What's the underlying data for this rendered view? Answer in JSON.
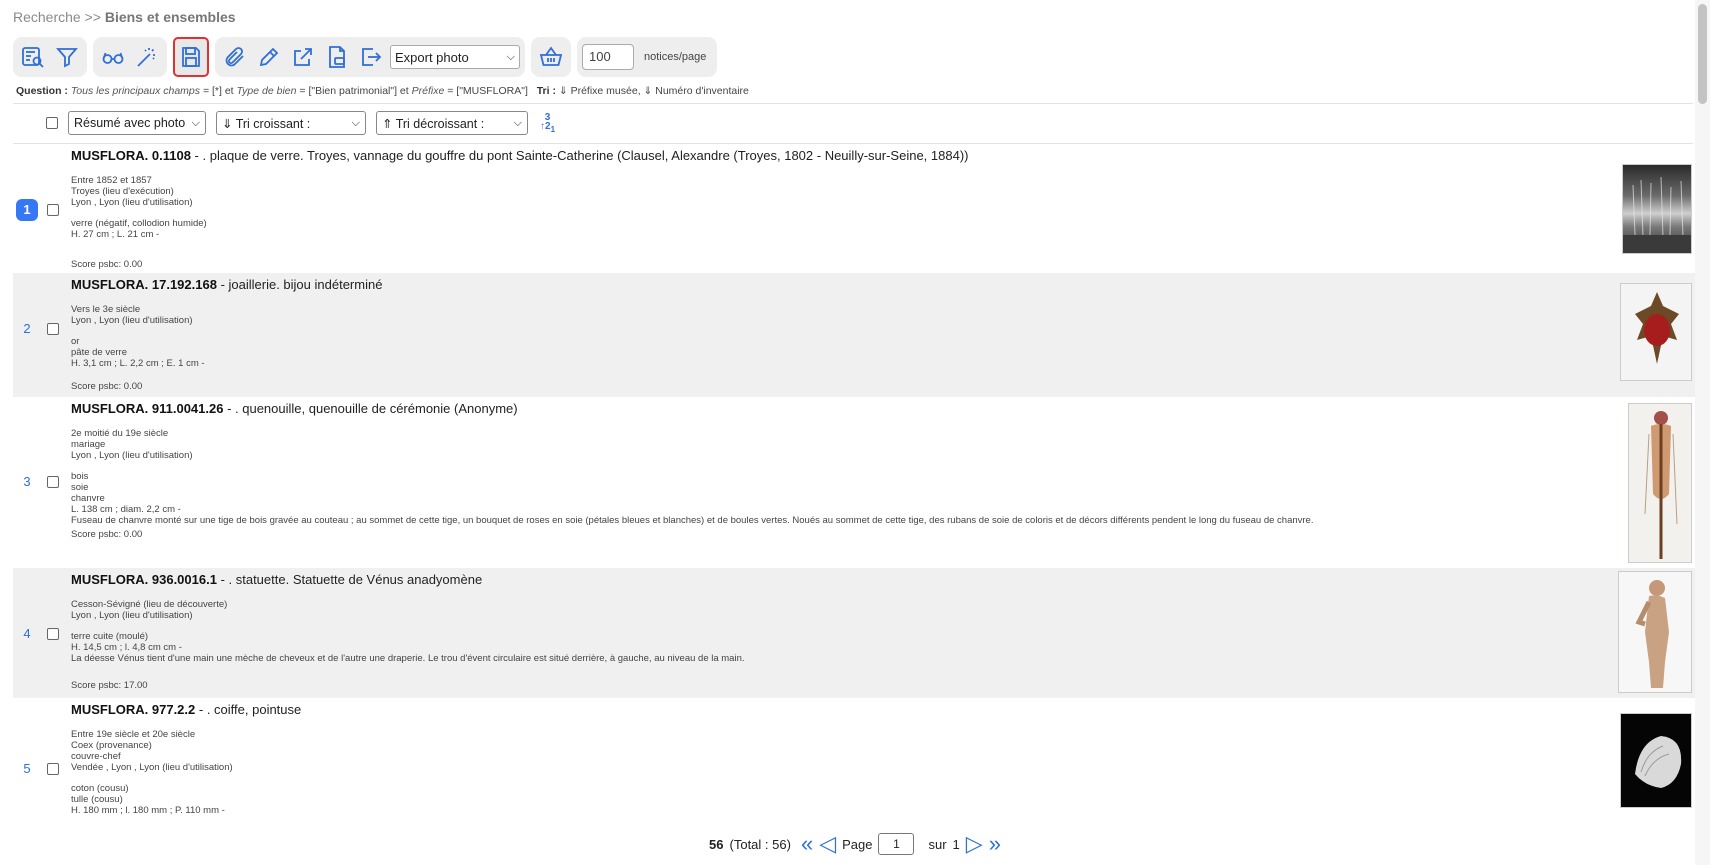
{
  "breadcrumb": {
    "root": "Recherche",
    "sep": ">>",
    "current": "Biens et ensembles"
  },
  "toolbar": {
    "export_select": "Export photo",
    "perpage_value": "100",
    "perpage_label": "notices/page",
    "icons": [
      "list-search-icon",
      "filter-icon",
      "glasses-icon",
      "magic-wand-icon",
      "save-icon",
      "paperclip-icon",
      "pencil-icon",
      "external-link-icon",
      "pdf-file-icon",
      "export-icon",
      "basket-icon"
    ]
  },
  "question": {
    "label": "Question :",
    "f1": "Tous les principaux champs",
    "v1": "= [*] et",
    "f2": "Type de bien",
    "v2": "= [\"Bien patrimonial\"] et",
    "f3": "Préfixe",
    "v3": "= [\"MUSFLORA\"]",
    "tri_label": "Tri :",
    "tri_value": "⇓ Préfixe musée, ⇓ Numéro d'inventaire"
  },
  "controls": {
    "view_select": "Résumé avec photo",
    "sort_asc": "⇓ Tri croissant :",
    "sort_desc": "⇑ Tri décroissant :"
  },
  "records": [
    {
      "num": "1",
      "id": "MUSFLORA. 0.1108",
      "title": " - . plaque de verre. Troyes, vannage du gouffre du pont Sainte-Catherine (Clausel, Alexandre (Troyes, 1802 - Neuilly-sur-Seine, 1884))",
      "lines": [
        "Entre 1852 et 1857",
        "Troyes (lieu d'exécution)",
        "Lyon , Lyon (lieu d'utilisation)",
        "",
        "verre (négatif, collodion humide)",
        "H. 27 cm ;  L. 21 cm  -"
      ],
      "score": "Score psbc: 0.00"
    },
    {
      "num": "2",
      "id": "MUSFLORA. 17.192.168",
      "title": " - joaillerie. bijou indéterminé",
      "lines": [
        "Vers le 3e siècle",
        "Lyon , Lyon (lieu d'utilisation)",
        "",
        "or",
        "pâte de verre",
        "H. 3,1 cm ;  L. 2,2 cm ;  E. 1 cm  -"
      ],
      "score": "Score psbc: 0.00"
    },
    {
      "num": "3",
      "id": "MUSFLORA. 911.0041.26",
      "title": " - . quenouille, quenouille de cérémonie (Anonyme)",
      "lines": [
        "2e moitié du 19e siècle",
        "mariage",
        "Lyon , Lyon (lieu d'utilisation)",
        "",
        "bois",
        "soie",
        "chanvre",
        "L. 138 cm ;  diam. 2,2 cm  -",
        "Fuseau de chanvre monté sur une tige de bois gravée au couteau ; au sommet de cette tige, un bouquet de roses en soie (pétales bleues et blanches) et de boules vertes. Noués au sommet de cette tige, des rubans de soie de coloris et de décors différents pendent le long du fuseau de chanvre."
      ],
      "score": "Score psbc: 0.00"
    },
    {
      "num": "4",
      "id": "MUSFLORA. 936.0016.1",
      "title": " - . statuette. Statuette de Vénus anadyomène",
      "lines": [
        "Cesson-Sévigné (lieu de découverte)",
        "Lyon , Lyon (lieu d'utilisation)",
        "",
        "terre cuite (moulé)",
        "H. 14,5 cm ;  l. 4,8 cm  cm -",
        "La déesse Vénus tient d'une main une mèche de cheveux et de l'autre une draperie. Le trou d'évent circulaire est situé derrière, à gauche, au niveau de la main."
      ],
      "score": "Score psbc: 17.00"
    },
    {
      "num": "5",
      "id": "MUSFLORA. 977.2.2",
      "title": " - . coiffe, pointuse",
      "lines": [
        "Entre 19e siècle et 20e siècle",
        "Coex (provenance)",
        "couvre-chef",
        "Vendée , Lyon , Lyon (lieu d'utilisation)",
        "",
        "coton (cousu)",
        "tulle (cousu)",
        "H. 180 mm ;  l. 180 mm ;  P. 110 mm  -"
      ],
      "score": ""
    }
  ],
  "pagination": {
    "count": "56",
    "total": "(Total : 56)",
    "page_label": "Page",
    "page_value": "1",
    "of_label": "sur",
    "of_value": "1"
  }
}
